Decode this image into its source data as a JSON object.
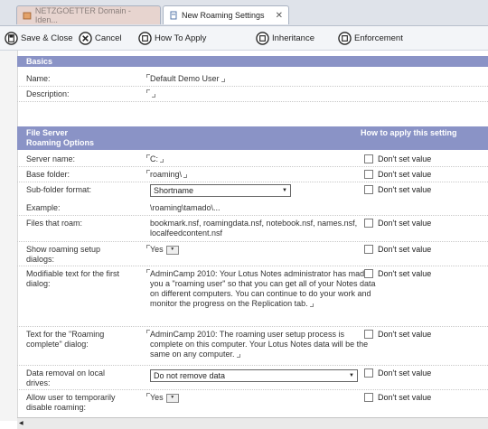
{
  "tabs": [
    {
      "label": "NETZGOETTER Domain - Iden...",
      "active": false
    },
    {
      "label": "New Roaming Settings",
      "active": true
    }
  ],
  "toolbar": {
    "save_close": "Save & Close",
    "cancel": "Cancel",
    "how_to_apply": "How To Apply",
    "inheritance": "Inheritance",
    "enforcement": "Enforcement"
  },
  "basics": {
    "title": "Basics",
    "name_label": "Name:",
    "name_value": "Default Demo User",
    "description_label": "Description:",
    "description_value": ""
  },
  "section": {
    "title_line1": "File Server",
    "title_line2": "Roaming Options",
    "how_header": "How to apply this setting"
  },
  "dont_set": "Don't set value",
  "rows": {
    "server_name": {
      "label": "Server name:",
      "value": "C:"
    },
    "base_folder": {
      "label": "Base folder:",
      "value": "roaming\\"
    },
    "subfolder": {
      "label": "Sub-folder format:",
      "value": "Shortname"
    },
    "example": {
      "label": "Example:",
      "value": "\\roaming\\tamado\\..."
    },
    "files": {
      "label": "Files that roam:",
      "value": "bookmark.nsf, roamingdata.nsf, notebook.nsf, names.nsf, localfeedcontent.nsf"
    },
    "show_dialogs": {
      "label": "Show roaming setup dialogs:",
      "value": "Yes"
    },
    "first_dialog": {
      "label": "Modifiable text for the first dialog:",
      "value": "AdminCamp 2010: Your Lotus Notes administrator has made you a \"roaming user\" so that you can get all of your Notes data on different computers. You can continue to do your work and monitor the progress on the Replication tab."
    },
    "complete_dialog": {
      "label": "Text for the \"Roaming complete\" dialog:",
      "value": "AdminCamp 2010: The roaming user setup process is complete on this computer. Your Lotus Notes data will be the same on any computer."
    },
    "data_removal": {
      "label": "Data removal on local drives:",
      "value": "Do not remove data"
    },
    "allow_disable": {
      "label": "Allow user to temporarily disable roaming:",
      "value": "Yes"
    }
  },
  "colors": {
    "band": "#8a93c6",
    "tab_inactive": "#e7d4cf"
  }
}
